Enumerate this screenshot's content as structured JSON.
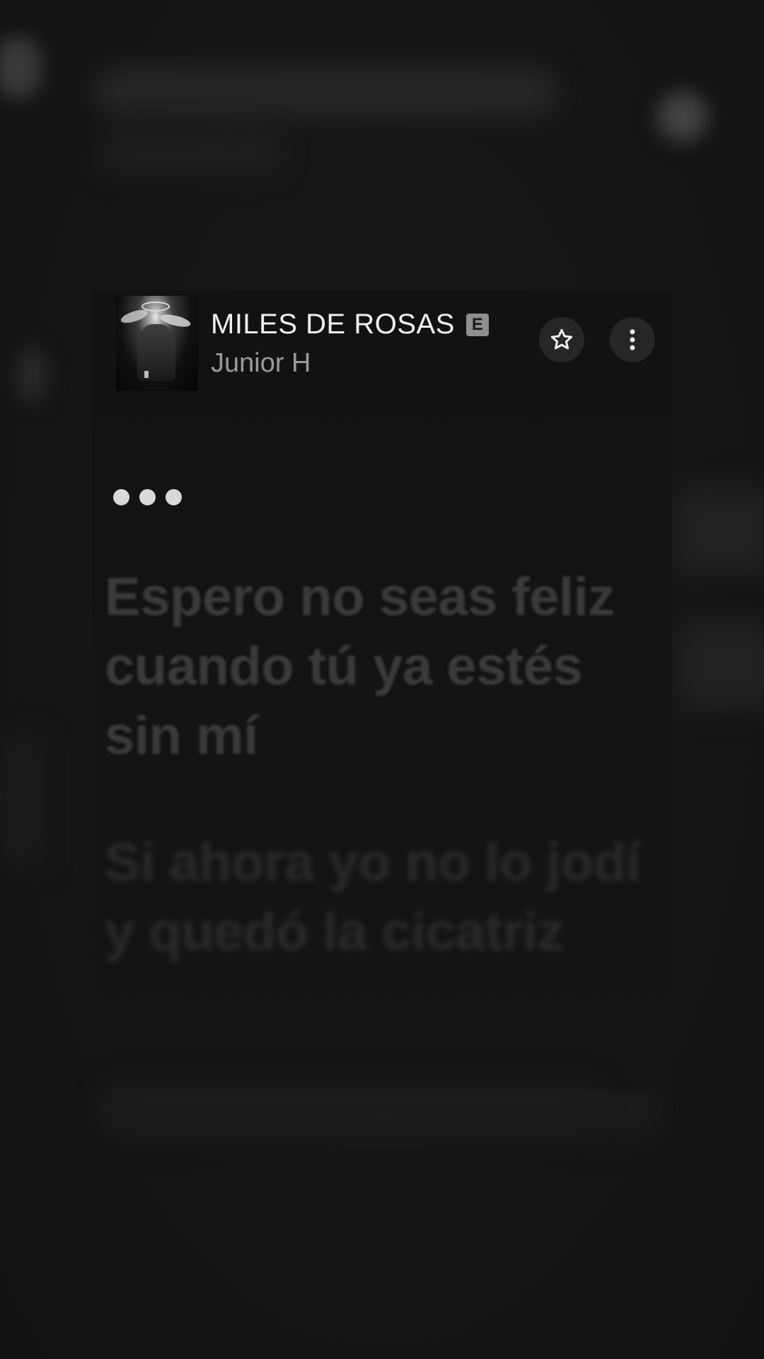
{
  "now_playing": {
    "title": "MILES DE ROSAS",
    "explicit_label": "E",
    "artist": "Junior H",
    "artwork_icon": "album-artwork",
    "favorite_icon": "star-icon",
    "more_icon": "more-vertical-icon"
  },
  "lyrics": {
    "waiting_indicator": "three-dots",
    "lines": [
      "Espero no seas feliz cuando tú ya estés sin mí",
      "Si ahora yo no lo jodí y quedó la cicatriz"
    ]
  },
  "colors": {
    "background": "#151515",
    "text_primary": "#f0f0f0",
    "text_secondary": "#9a9a9a",
    "lyric_upcoming": "#3a3a3a",
    "button_bg": "#262626"
  }
}
